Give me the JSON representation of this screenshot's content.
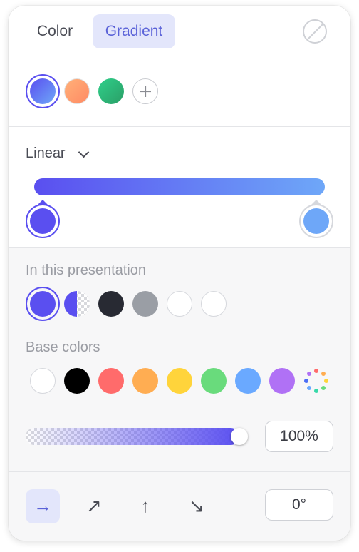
{
  "tabs": {
    "color_label": "Color",
    "gradient_label": "Gradient"
  },
  "gradient_presets": [
    {
      "name": "blue-purple",
      "from": "#5a4ff0",
      "to": "#6ea7f8",
      "selected": true
    },
    {
      "name": "orange",
      "from": "#ffb078",
      "to": "#ff8a64"
    },
    {
      "name": "green",
      "from": "#2fcf8a",
      "to": "#2a9e66"
    }
  ],
  "gradient": {
    "type_label": "Linear",
    "stops": [
      {
        "position_pct": 0,
        "color": "#5a4ff0"
      },
      {
        "position_pct": 100,
        "color": "#6ea7f8"
      }
    ]
  },
  "in_presentation": {
    "label": "In this presentation",
    "colors": [
      "#5a4ff0",
      "#5a4ff0 half-transparent",
      "#282a33",
      "#9a9ea5",
      "#ffffff",
      "#ffffff"
    ]
  },
  "base_colors": {
    "label": "Base colors",
    "colors": [
      "#ffffff",
      "#000000",
      "#ff6b6b",
      "#ffad52",
      "#ffd43b",
      "#69db7c",
      "#6aa9ff",
      "#b071f5"
    ]
  },
  "opacity": {
    "value": "100%",
    "fraction": 1.0
  },
  "angle": {
    "value": "0°"
  },
  "directions": [
    {
      "name": "right",
      "glyph": "→",
      "active": true
    },
    {
      "name": "up-right",
      "glyph": "↗"
    },
    {
      "name": "up",
      "glyph": "↑"
    },
    {
      "name": "down-right",
      "glyph": "↘"
    }
  ],
  "colors": {
    "accent": "#5a4ff0",
    "tab_active_bg": "#e3e6fb",
    "tab_active_text": "#5a62d8"
  }
}
